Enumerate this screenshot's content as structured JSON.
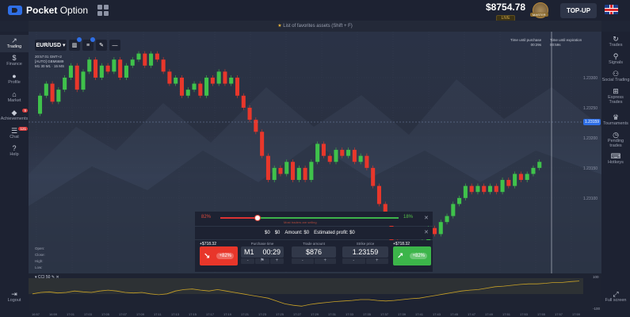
{
  "brand": {
    "name_bold": "Pocket",
    "name_rest": " Option"
  },
  "header": {
    "balance": "$8754.78",
    "account_type": "LIVE",
    "avatar_badge": "MASTER",
    "topup_label": "TOP-UP"
  },
  "favorites_bar": {
    "star": "★",
    "text": " List of favorites assets (Shift + F)"
  },
  "left_sidebar": [
    {
      "label": "Trading",
      "icon": "↗"
    },
    {
      "label": "Finance",
      "icon": "$"
    },
    {
      "label": "Profile",
      "icon": "●"
    },
    {
      "label": "Market",
      "icon": "⌂"
    },
    {
      "label": "Achievements",
      "icon": "◆",
      "badge": "9"
    },
    {
      "label": "Chat",
      "icon": "☰",
      "badge": "121"
    },
    {
      "label": "Help",
      "icon": "?"
    },
    {
      "label": "Logout",
      "icon": "⇥"
    }
  ],
  "right_sidebar": [
    {
      "label": "Trades",
      "icon": "↻"
    },
    {
      "label": "Signals",
      "icon": "⚲"
    },
    {
      "label": "Social Trading",
      "icon": "⚇"
    },
    {
      "label": "Express Trades",
      "icon": "⊞"
    },
    {
      "label": "Tournaments",
      "icon": "♛"
    },
    {
      "label": "Pending trades",
      "icon": "◷"
    },
    {
      "label": "Hotkeys",
      "icon": "⌨"
    },
    {
      "label": "Full screen",
      "icon": "⤢"
    }
  ],
  "toolbar": {
    "pair": "EUR/USD",
    "pair_icon": "chevron-down-icon"
  },
  "chart_info": {
    "time": "20:57:01 GMT+2",
    "line2": "[AUTO] GBM6689",
    "line3": "M1 30 M1 · 15 MS"
  },
  "time_labels": {
    "purchase": "Time until purchase",
    "purchase_val": "00:29s",
    "expiration": "Time until expiration",
    "expiration_val": "00:59s"
  },
  "ohlc": {
    "open": "Open:",
    "close": "Close:",
    "high": "High:",
    "low": "Low:"
  },
  "current_price": "1.23159",
  "sentiment": {
    "down": "82%",
    "up": "18%",
    "caption": "Most traders are selling"
  },
  "profit_row": {
    "a": "$0",
    "b": "$0",
    "amount": "Amount: $0",
    "estimated": "Estimated profit: $0"
  },
  "trade": {
    "sell_price": "+$718.32",
    "buy_price": "+$718.32",
    "sell_pct": "+82%",
    "buy_pct": "+82%",
    "purchase_time_label": "Purchase time",
    "purchase_tf": "M1",
    "purchase_time": "00:29",
    "amount_label": "Trade amount",
    "amount": "$876",
    "strike_label": "Strike price",
    "strike": "1.23159"
  },
  "indicator": {
    "name": "CCI 50",
    "scale_top": "100",
    "scale_bottom": "-100"
  },
  "time_axis": [
    "16:57",
    "16:59",
    "17:01",
    "17:03",
    "17:05",
    "17:07",
    "17:09",
    "17:11",
    "17:13",
    "17:15",
    "17:17",
    "17:19",
    "17:21",
    "17:23",
    "17:25",
    "17:27",
    "17:29",
    "17:31",
    "17:33",
    "17:35",
    "17:37",
    "17:39",
    "17:41",
    "17:43",
    "17:45",
    "17:47",
    "17:49",
    "17:51",
    "17:53",
    "17:55",
    "17:57",
    "17:59"
  ],
  "chart_data": {
    "type": "candlestick",
    "y_ticks": [
      "1.23100",
      "1.23150",
      "1.23200",
      "1.23250",
      "1.23300"
    ],
    "ylim": [
      1.2308,
      1.2335
    ],
    "colors": {
      "up": "#3fc24b",
      "down": "#e8372b"
    },
    "candles": [
      [
        1.2324,
        1.2327
      ],
      [
        1.2327,
        1.2329
      ],
      [
        1.2329,
        1.2326
      ],
      [
        1.2326,
        1.2328
      ],
      [
        1.2328,
        1.233
      ],
      [
        1.233,
        1.2332
      ],
      [
        1.2332,
        1.2328
      ],
      [
        1.2328,
        1.2331
      ],
      [
        1.2331,
        1.2333
      ],
      [
        1.2333,
        1.233
      ],
      [
        1.233,
        1.2332
      ],
      [
        1.2332,
        1.2331
      ],
      [
        1.2331,
        1.2333
      ],
      [
        1.2333,
        1.233
      ],
      [
        1.233,
        1.2332
      ],
      [
        1.2332,
        1.2333
      ],
      [
        1.2333,
        1.2334
      ],
      [
        1.2334,
        1.2332
      ],
      [
        1.2332,
        1.2334
      ],
      [
        1.2334,
        1.2333
      ],
      [
        1.2333,
        1.2331
      ],
      [
        1.2331,
        1.2329
      ],
      [
        1.2329,
        1.233
      ],
      [
        1.233,
        1.2327
      ],
      [
        1.2327,
        1.2328
      ],
      [
        1.2328,
        1.2329
      ],
      [
        1.2329,
        1.2327
      ],
      [
        1.2327,
        1.233
      ],
      [
        1.233,
        1.2329
      ],
      [
        1.2329,
        1.2331
      ],
      [
        1.2331,
        1.2329
      ],
      [
        1.2329,
        1.233
      ],
      [
        1.233,
        1.2327
      ],
      [
        1.2327,
        1.2325
      ],
      [
        1.2325,
        1.2323
      ],
      [
        1.2323,
        1.2321
      ],
      [
        1.2321,
        1.2317
      ],
      [
        1.2317,
        1.2313
      ],
      [
        1.2313,
        1.2315
      ],
      [
        1.2315,
        1.2314
      ],
      [
        1.2314,
        1.2316
      ],
      [
        1.2316,
        1.2313
      ],
      [
        1.2313,
        1.2315
      ],
      [
        1.2315,
        1.2313
      ],
      [
        1.2313,
        1.2316
      ],
      [
        1.2316,
        1.2319
      ],
      [
        1.2319,
        1.2317
      ],
      [
        1.2317,
        1.2316
      ],
      [
        1.2316,
        1.2318
      ],
      [
        1.2318,
        1.2317
      ],
      [
        1.2317,
        1.2318
      ],
      [
        1.2318,
        1.2316
      ],
      [
        1.2316,
        1.2317
      ],
      [
        1.2317,
        1.2315
      ],
      [
        1.2315,
        1.2312
      ],
      [
        1.2312,
        1.2309
      ],
      [
        1.2309,
        1.2306
      ],
      [
        1.2306,
        1.2303
      ],
      [
        1.2303,
        1.2301
      ],
      [
        1.2301,
        1.23
      ],
      [
        1.23,
        1.2302
      ],
      [
        1.2302,
        1.2301
      ],
      [
        1.2301,
        1.2303
      ],
      [
        1.2303,
        1.2305
      ],
      [
        1.2305,
        1.2304
      ],
      [
        1.2304,
        1.2306
      ],
      [
        1.2306,
        1.2307
      ],
      [
        1.2307,
        1.2309
      ],
      [
        1.2309,
        1.231
      ],
      [
        1.231,
        1.2312
      ],
      [
        1.2312,
        1.2311
      ],
      [
        1.2311,
        1.2312
      ],
      [
        1.2312,
        1.2311
      ],
      [
        1.2311,
        1.2312
      ],
      [
        1.2312,
        1.2311
      ],
      [
        1.2311,
        1.2313
      ],
      [
        1.2313,
        1.2312
      ],
      [
        1.2312,
        1.2314
      ],
      [
        1.2314,
        1.2313
      ],
      [
        1.2313,
        1.2314
      ],
      [
        1.2314,
        1.2315
      ],
      [
        1.2315,
        1.2316
      ]
    ],
    "indicator_series": [
      0.45,
      0.5,
      0.52,
      0.48,
      0.5,
      0.55,
      0.52,
      0.5,
      0.55,
      0.58,
      0.55,
      0.5,
      0.48,
      0.5,
      0.45,
      0.42,
      0.45,
      0.55,
      0.6,
      0.62,
      0.58,
      0.55,
      0.6,
      0.55,
      0.5,
      0.45,
      0.4,
      0.35,
      0.3,
      0.2,
      0.1,
      0.05,
      0.02,
      0.08,
      0.12,
      0.15,
      0.18,
      0.2,
      0.22,
      0.25,
      0.25,
      0.22,
      0.2,
      0.22,
      0.25,
      0.28,
      0.3,
      0.35,
      0.4,
      0.45,
      0.5,
      0.55,
      0.58,
      0.6,
      0.65,
      0.7,
      0.72,
      0.75,
      0.78,
      0.8,
      0.8,
      0.82,
      0.85,
      0.85,
      0.88,
      0.9
    ]
  }
}
